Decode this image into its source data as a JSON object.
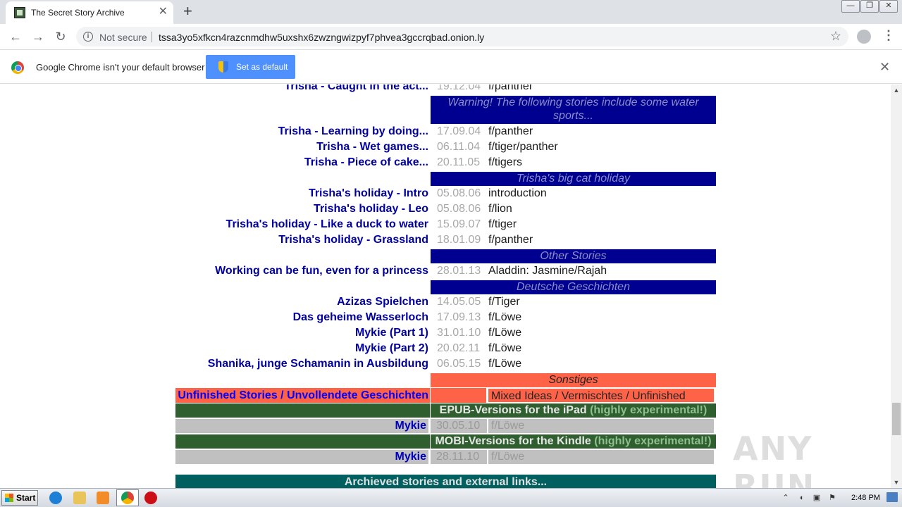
{
  "browser": {
    "tab_title": "The Secret Story Archive",
    "tab_close": "✕",
    "new_tab": "+",
    "window_buttons": [
      "—",
      "❐",
      "✕"
    ],
    "nav": {
      "back": "←",
      "forward": "→",
      "reload": "↻"
    },
    "not_secure": "Not secure",
    "url": "tssa3yo5xfkcn4razcnmdhw5uxshx6zwzngwizpyf7phvea3gccrqbad.onion.ly",
    "bookmark_icon": "☆",
    "menu": "⋮"
  },
  "infobar": {
    "message": "Google Chrome isn't your default browser",
    "button": "Set as default",
    "close": "✕"
  },
  "stories": [
    {
      "title": "Trisha - Caught in the act...",
      "date": "19.12.04",
      "cat": "f/panther"
    },
    {
      "title": "Trisha - Learning by doing...",
      "date": "17.09.04",
      "cat": "f/panther"
    },
    {
      "title": "Trisha - Wet games...",
      "date": "06.11.04",
      "cat": "f/tiger/panther"
    },
    {
      "title": "Trisha - Piece of cake...",
      "date": "20.11.05",
      "cat": "f/tigers"
    },
    {
      "title": "Trisha's holiday - Intro",
      "date": "05.08.06",
      "cat": "introduction"
    },
    {
      "title": "Trisha's holiday - Leo",
      "date": "05.08.06",
      "cat": "f/lion"
    },
    {
      "title": "Trisha's holiday - Like a duck to water",
      "date": "15.09.07",
      "cat": "f/tiger"
    },
    {
      "title": "Trisha's holiday - Grassland",
      "date": "18.01.09",
      "cat": "f/panther"
    },
    {
      "title": "Working can be fun, even for a princess",
      "date": "28.01.13",
      "cat": "Aladdin: Jasmine/Rajah"
    },
    {
      "title": "Azizas Spielchen",
      "date": "14.05.05",
      "cat": "f/Tiger"
    },
    {
      "title": "Das geheime Wasserloch",
      "date": "17.09.13",
      "cat": "f/Löwe"
    },
    {
      "title": "Mykie (Part 1)",
      "date": "31.01.10",
      "cat": "f/Löwe"
    },
    {
      "title": "Mykie (Part 2)",
      "date": "20.02.11",
      "cat": "f/Löwe"
    },
    {
      "title": "Shanika, junge Schamanin in Ausbildung",
      "date": "06.05.15",
      "cat": "f/Löwe"
    }
  ],
  "headers": {
    "warning": "Warning! The following stories include some water sports...",
    "holiday": "Trisha's big cat holiday",
    "other": "Other Stories",
    "deutsch": "Deutsche Geschichten",
    "sonstiges": "Sonstiges"
  },
  "unfinished": {
    "label": "Unfinished Stories / Unvollendete Geschichten",
    "right": "Mixed Ideas / Vermischtes / Unfinished"
  },
  "epub": {
    "label": "EPUB-Versions for the iPad",
    "note": "(highly experimental!)",
    "title": "Mykie",
    "date": "30.05.10",
    "cat": "f/Löwe"
  },
  "mobi": {
    "label": "MOBI-Versions for the Kindle",
    "note": "(highly experimental!)",
    "title": "Mykie",
    "date": "28.11.10",
    "cat": "f/Löwe"
  },
  "archive": "Archieved stories and external links...",
  "watermark": "ANY RUN",
  "taskbar": {
    "start": "Start",
    "clock": "2:48 PM"
  },
  "colors": {
    "link": "#0000a0",
    "header_bg": "#000090",
    "sonstiges_bg": "#ff6347",
    "green_bg": "#2f5f2f",
    "archive_bg": "#006060"
  }
}
